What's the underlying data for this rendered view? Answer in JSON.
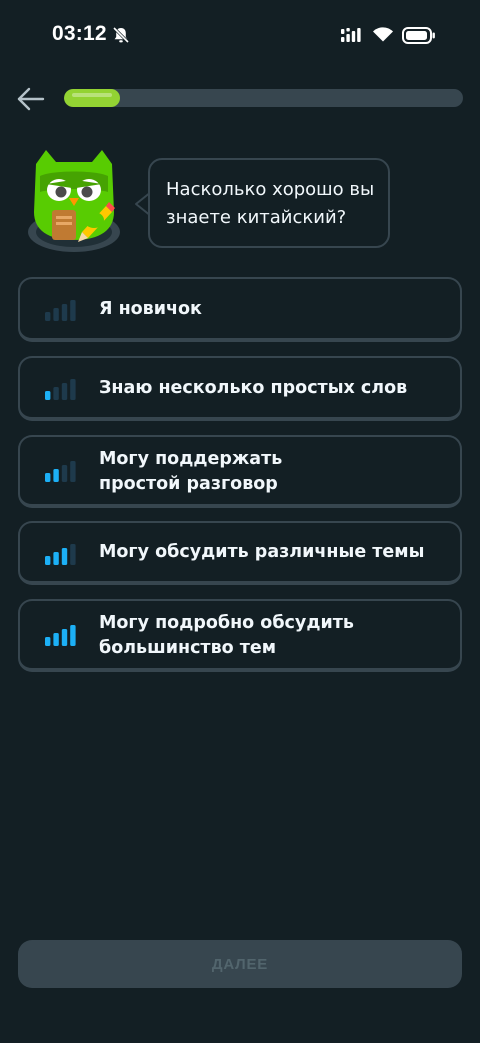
{
  "status_bar": {
    "time": "03:12",
    "icons": [
      "bell-off-icon",
      "signal-icon",
      "wifi-icon",
      "battery-icon"
    ]
  },
  "header": {
    "back_icon": "arrow-left-icon",
    "progress_fraction": 0.14
  },
  "prompt": {
    "mascot": "owl-mascot",
    "question": "Насколько хорошо вы знаете китайский?"
  },
  "options": [
    {
      "label": "Я новичок",
      "level": 0
    },
    {
      "label": "Знаю несколько простых слов",
      "level": 1
    },
    {
      "label": "Могу поддержать простой разговор",
      "level": 2
    },
    {
      "label": "Могу обсудить различные темы",
      "level": 3
    },
    {
      "label": "Могу подробно обсудить большинство тем",
      "level": 4
    }
  ],
  "footer": {
    "continue_label": "ДАЛЕЕ"
  },
  "colors": {
    "background": "#131f24",
    "border": "#37464f",
    "progress_fill": "#93d333",
    "bar_active": "#1cb0f6",
    "bar_inactive": "#1e3a4c",
    "disabled_button": "#37464f",
    "disabled_text": "#52656d"
  }
}
